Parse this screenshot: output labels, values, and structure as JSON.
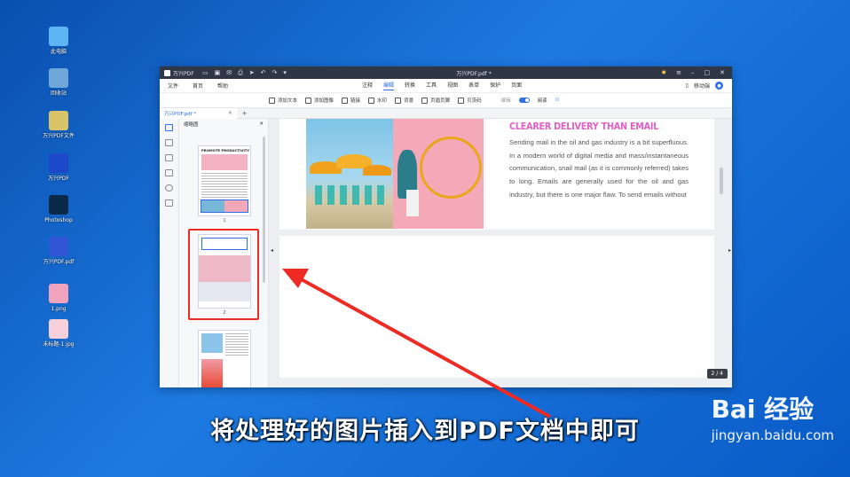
{
  "desktop": {
    "icons": [
      {
        "label": "此电脑",
        "icon": "computer-icon",
        "color": "#5fb4f3"
      },
      {
        "label": "回收站",
        "icon": "recycle-bin-icon",
        "color": "#6fa8d8"
      },
      {
        "label": "万兴PDF文件",
        "icon": "pdf-file-icon",
        "color": "#d9c46a"
      },
      {
        "label": "万兴PDF",
        "icon": "wondershare-pdf-icon",
        "color": "#1d48c9"
      },
      {
        "label": "Photoshop",
        "icon": "photoshop-icon",
        "color": "#0b2a4a"
      },
      {
        "label": "万兴PDF.pdf",
        "icon": "pdf-document-icon",
        "color": "#3056d6"
      },
      {
        "label": "1.png",
        "icon": "png-image-icon",
        "color": "#f1a3bd"
      },
      {
        "label": "未标题-1.jpg",
        "icon": "jpg-image-icon",
        "color": "#f5d0da"
      }
    ]
  },
  "window": {
    "app_name": "万兴PDF",
    "title": "万兴PDF.pdf *",
    "menu_left": [
      "文件",
      "首页",
      "帮助"
    ],
    "menu_center": [
      "注释",
      "编辑",
      "转换",
      "工具",
      "视图",
      "表单",
      "保护",
      "页面"
    ],
    "active_menu": "编辑",
    "mobile_label": "移动端",
    "toolbar": [
      "添加文本",
      "添加图像",
      "链接",
      "水印",
      "背景",
      "页眉页脚",
      "贝茨码"
    ],
    "toolbar_right": [
      "编辑",
      "阅读"
    ],
    "tab_label": "万兴PDF.pdf *",
    "tab_add": "+",
    "thumbs_title": "缩略图",
    "thumb_title_text": "PROMOTE PRODUCTIVITY",
    "page_numbers": [
      "1",
      "2",
      "3"
    ],
    "heading": "CLEARER DELIVERY THAN EMAIL",
    "paragraph": "Sending mail in the oil and gas industry is a bit superfluous. In a modern world of digital media and mass/instantaneous communication, snail mail (as it is commonly referred) takes to long. Emails are generally used for the oil and gas industry, but there is one major flaw. To send emails without",
    "pager": "2 / 4",
    "accent": "#2d6ee6",
    "heading_color": "#e25fc3"
  },
  "caption": "将处理好的图片插入到PDF文档中即可",
  "watermark": {
    "main": "Bai 经验",
    "sub": "jingyan.baidu.com"
  },
  "annotation_color": "#ee2a24"
}
